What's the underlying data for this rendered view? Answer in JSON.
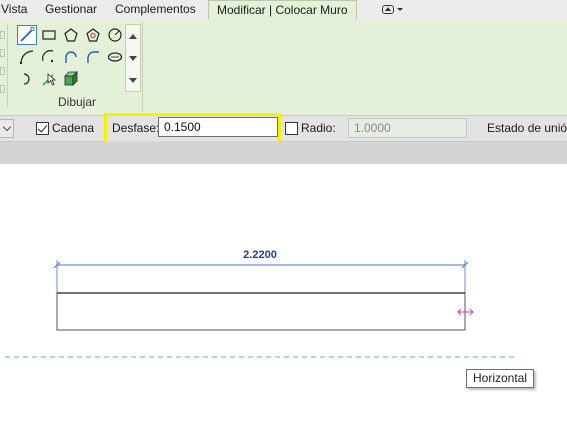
{
  "tabs": [
    {
      "label": "Vista"
    },
    {
      "label": "Gestionar"
    },
    {
      "label": "Complementos"
    },
    {
      "label": "Modificar | Colocar Muro"
    }
  ],
  "ribbon": {
    "draw_panel_title": "Dibujar",
    "tools": [
      {
        "name": "line-icon"
      },
      {
        "name": "rectangle-icon"
      },
      {
        "name": "inscribed-polygon-icon"
      },
      {
        "name": "circumscribed-polygon-icon"
      },
      {
        "name": "circle-icon"
      },
      {
        "name": "start-end-arc-icon"
      },
      {
        "name": "center-ends-arc-icon"
      },
      {
        "name": "tangent-end-arc-icon"
      },
      {
        "name": "fillet-arc-icon"
      },
      {
        "name": "ellipse-icon"
      },
      {
        "name": "partial-ellipse-icon"
      },
      {
        "name": "pick-lines-icon"
      },
      {
        "name": "pick-faces-icon"
      }
    ]
  },
  "options": {
    "chain_label": "Cadena",
    "chain_checked": true,
    "offset_label": "Desfase:",
    "offset_value": "0.1500",
    "radius_label": "Radio:",
    "radius_checked": false,
    "radius_value": "1.0000",
    "join_status_label": "Estado de unión"
  },
  "canvas": {
    "dimension_value": "2.2200",
    "tooltip": "Horizontal"
  },
  "colors": {
    "ribbon_bg": "#e4f0d8",
    "highlight": "#f5f200",
    "dimension_line": "#4a6fd6",
    "dimension_text": "#1d3f8c",
    "snap_marker": "#c040c0",
    "alignment_line": "#6cc8d8"
  }
}
